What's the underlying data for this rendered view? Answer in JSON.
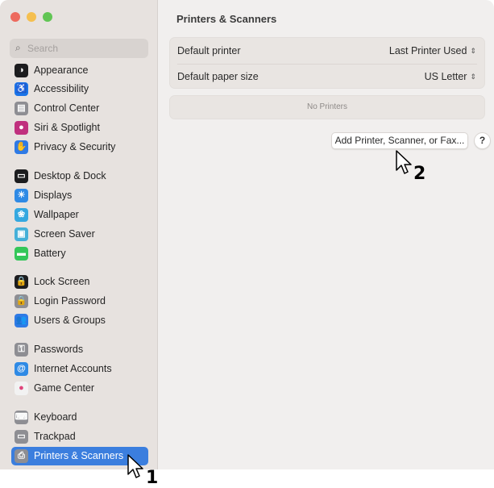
{
  "window": {
    "title": "Printers & Scanners"
  },
  "sidebar": {
    "search_placeholder": "Search",
    "items": [
      {
        "label": "Appearance",
        "icon": "appearance-icon",
        "color": "#1d1d1f",
        "glyph": "◑"
      },
      {
        "label": "Accessibility",
        "icon": "accessibility-icon",
        "color": "#1a73e8",
        "glyph": "♿"
      },
      {
        "label": "Control Center",
        "icon": "control-center-icon",
        "color": "#8e8e93",
        "glyph": "▤"
      },
      {
        "label": "Siri & Spotlight",
        "icon": "siri-icon",
        "color": "#c0307e",
        "glyph": "●"
      },
      {
        "label": "Privacy & Security",
        "icon": "hand-icon",
        "color": "#2f7ae5",
        "glyph": "✋"
      },
      {
        "label": "Desktop & Dock",
        "icon": "desktop-dock-icon",
        "color": "#1d1d1f",
        "glyph": "▭"
      },
      {
        "label": "Displays",
        "icon": "displays-icon",
        "color": "#2f8ae5",
        "glyph": "☀"
      },
      {
        "label": "Wallpaper",
        "icon": "wallpaper-icon",
        "color": "#35a8e0",
        "glyph": "❀"
      },
      {
        "label": "Screen Saver",
        "icon": "screen-saver-icon",
        "color": "#45b0d8",
        "glyph": "▣"
      },
      {
        "label": "Battery",
        "icon": "battery-icon",
        "color": "#34c759",
        "glyph": "▬"
      },
      {
        "label": "Lock Screen",
        "icon": "lock-screen-icon",
        "color": "#1d1d1f",
        "glyph": "🔒"
      },
      {
        "label": "Login Password",
        "icon": "login-password-icon",
        "color": "#8e8e93",
        "glyph": "🔒"
      },
      {
        "label": "Users & Groups",
        "icon": "users-groups-icon",
        "color": "#2f7ae5",
        "glyph": "👥"
      },
      {
        "label": "Passwords",
        "icon": "passwords-icon",
        "color": "#8e8e93",
        "glyph": "⚿"
      },
      {
        "label": "Internet Accounts",
        "icon": "internet-accounts-icon",
        "color": "#2f8ae5",
        "glyph": "@"
      },
      {
        "label": "Game Center",
        "icon": "game-center-icon",
        "color": "#f2f2f2",
        "glyph": "●"
      },
      {
        "label": "Keyboard",
        "icon": "keyboard-icon",
        "color": "#8e8e93",
        "glyph": "⌨"
      },
      {
        "label": "Trackpad",
        "icon": "trackpad-icon",
        "color": "#8e8e93",
        "glyph": "▭"
      },
      {
        "label": "Printers & Scanners",
        "icon": "printer-icon",
        "color": "#8e8e93",
        "glyph": "⎙",
        "selected": true
      }
    ]
  },
  "main": {
    "title": "Printers & Scanners",
    "default_printer_label": "Default printer",
    "default_printer_value": "Last Printer Used",
    "default_paper_label": "Default paper size",
    "default_paper_value": "US Letter",
    "no_printers": "No Printers",
    "add_button": "Add Printer, Scanner, or Fax...",
    "help_button": "?"
  },
  "annotations": {
    "cursor1_number": "1",
    "cursor2_number": "2"
  },
  "colors": {
    "accent": "#3b7ede",
    "sidebar_bg": "#e7e2df",
    "main_bg": "#f1efee"
  }
}
